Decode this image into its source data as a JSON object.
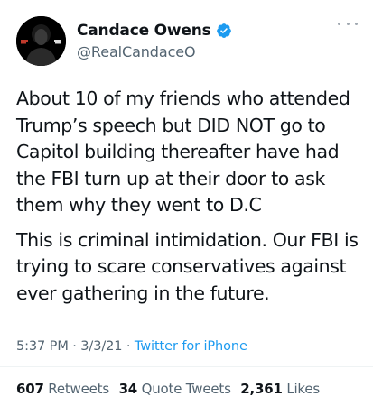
{
  "user": {
    "display_name": "Candace Owens",
    "handle": "@RealCandaceO",
    "verified": true,
    "verified_color": "#1d9bf0"
  },
  "tweet": {
    "paragraphs": [
      "About 10 of my friends who attended Trump’s speech but DID NOT go to Capitol building thereafter have had the FBI turn up at their door to ask them why they went to D.C",
      "This is criminal intimidation. Our FBI is trying to scare conservatives against ever gathering in the future."
    ],
    "time": "5:37 PM",
    "date": "3/3/21",
    "separator": "·",
    "source": "Twitter for iPhone"
  },
  "stats": {
    "retweets_count": "607",
    "retweets_label": "Retweets",
    "quotes_count": "34",
    "quotes_label": "Quote Tweets",
    "likes_count": "2,361",
    "likes_label": "Likes"
  },
  "colors": {
    "text": "#0f1419",
    "secondary": "#536471",
    "link": "#1d9bf0"
  },
  "icons": {
    "avatar": "profile-avatar",
    "verified": "verified-badge-icon",
    "more": "more-options-icon"
  }
}
